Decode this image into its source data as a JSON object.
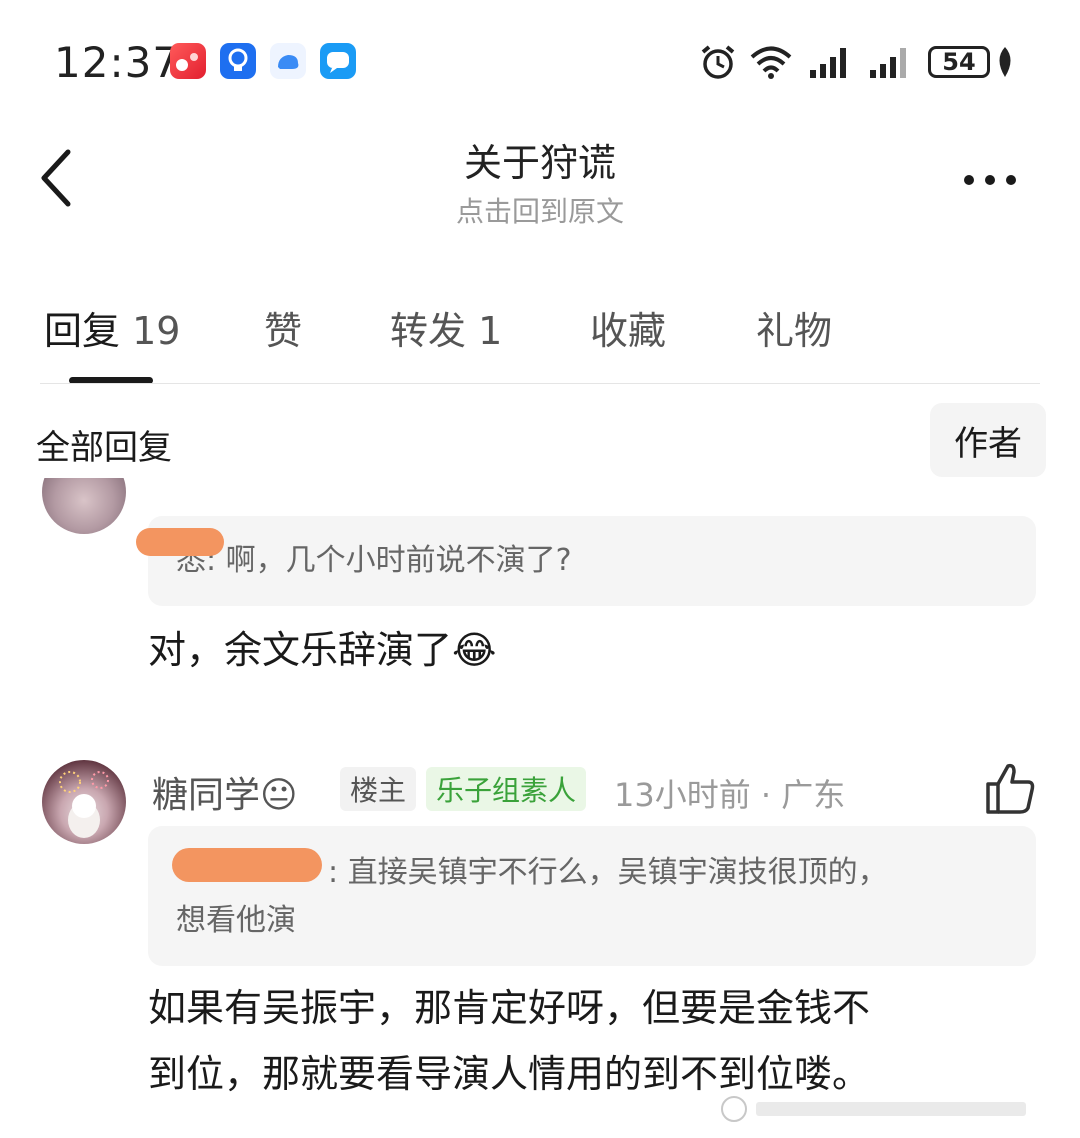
{
  "status_bar": {
    "time": "12:37",
    "battery": "54",
    "app_icons": [
      "red-app-icon",
      "bulb-app-icon",
      "cloud-app-icon",
      "message-app-icon"
    ]
  },
  "header": {
    "title": "关于狩谎",
    "subtitle": "点击回到原文"
  },
  "tabs": [
    {
      "label": "回复",
      "count": "19",
      "active": true
    },
    {
      "label": "赞",
      "count": "",
      "active": false
    },
    {
      "label": "转发",
      "count": "1",
      "active": false
    },
    {
      "label": "收藏",
      "count": "",
      "active": false
    },
    {
      "label": "礼物",
      "count": "",
      "active": false
    }
  ],
  "filter": {
    "all_label": "全部回复",
    "author_label": "作者"
  },
  "comments": [
    {
      "quote": "悉: 啊，几个小时前说不演了?",
      "text": "对，余文乐辞演了",
      "emoji": "😂"
    },
    {
      "username": "糖同学",
      "user_emoji": "😐",
      "badge_owner": "楼主",
      "badge_tag": "乐子组素人",
      "time_location": "13小时前 · 广东",
      "quote_line1": ": 直接吴镇宇不行么，吴镇宇演技很顶的，",
      "quote_line2": "想看他演",
      "text_line1": "如果有吴振宇，那肯定好呀，但要是金钱不",
      "text_line2": "到位，那就要看导演人情用的到不到位喽。"
    }
  ],
  "colors": {
    "tag_green": "#3aa23a",
    "redaction_orange": "#f39560"
  }
}
